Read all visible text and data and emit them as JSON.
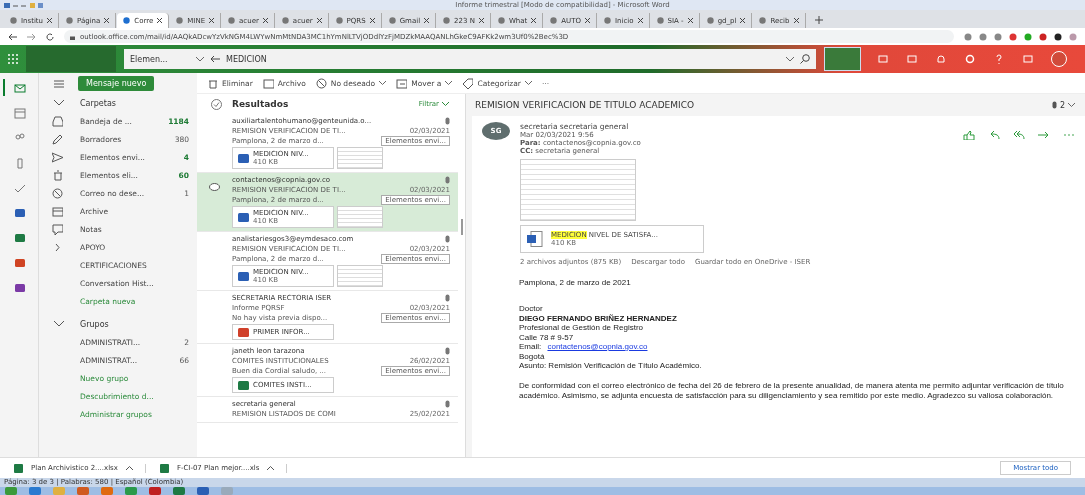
{
  "word_title": "Informe trimestral [Modo de compatibilidad] - Microsoft Word",
  "browser_tabs": [
    {
      "label": "Institu",
      "selected": false
    },
    {
      "label": "Página",
      "selected": false
    },
    {
      "label": "Corre",
      "selected": true
    },
    {
      "label": "MINE",
      "selected": false
    },
    {
      "label": "acuer",
      "selected": false
    },
    {
      "label": "acuer",
      "selected": false
    },
    {
      "label": "PQRS",
      "selected": false
    },
    {
      "label": "Gmail",
      "selected": false
    },
    {
      "label": "223 N",
      "selected": false
    },
    {
      "label": "What",
      "selected": false
    },
    {
      "label": "AUTO",
      "selected": false
    },
    {
      "label": "Inicio",
      "selected": false
    },
    {
      "label": "SIA -",
      "selected": false
    },
    {
      "label": "gd_pl",
      "selected": false
    },
    {
      "label": "Recib",
      "selected": false
    }
  ],
  "address": "outlook.office.com/mail/id/AAQkADcwYzVkNGM4LWYwNmMtNDA3MC1hYmNlLTVjODdlYzFjMDZkMAAQANLhGkeC9AFKk2wm3Uf0%2Bec%3D",
  "outlook_header": {
    "search_scope": "Elemen...",
    "search_query": "MEDICION"
  },
  "new_message": "Mensaje nuevo",
  "toolbar": [
    "Eliminar",
    "Archivo",
    "No deseado",
    "Mover a",
    "Categorizar",
    "···"
  ],
  "rail": [
    {
      "kind": "mail",
      "selected": true
    },
    {
      "kind": "calendar",
      "selected": false
    },
    {
      "kind": "people",
      "selected": false
    },
    {
      "kind": "files",
      "selected": false
    },
    {
      "kind": "todo",
      "selected": false
    },
    {
      "kind": "word",
      "selected": false
    },
    {
      "kind": "excel",
      "selected": false
    },
    {
      "kind": "powerpoint",
      "selected": false
    },
    {
      "kind": "onenote",
      "selected": false
    }
  ],
  "folders_heading": "Carpetas",
  "folders": [
    {
      "kind": "inbox",
      "label": "Bandeja de ...",
      "count": "1184",
      "bold": true
    },
    {
      "kind": "pencil",
      "label": "Borradores",
      "count": "380",
      "bold": false
    },
    {
      "kind": "send",
      "label": "Elementos envi...",
      "count": "4",
      "bold": true
    },
    {
      "kind": "trash",
      "label": "Elementos eli...",
      "count": "60",
      "bold": true
    },
    {
      "kind": "block",
      "label": "Correo no dese...",
      "count": "1",
      "bold": false
    },
    {
      "kind": "archive",
      "label": "Archive"
    },
    {
      "kind": "note",
      "label": "Notas"
    },
    {
      "kind": "chevron",
      "label": "APOYO"
    },
    {
      "kind": "plain",
      "label": "CERTIFICACIONES"
    },
    {
      "kind": "plain",
      "label": "Conversation Hist..."
    },
    {
      "kind": "plain",
      "label": "Carpeta nueva",
      "link": true
    }
  ],
  "groups_heading": "Grupos",
  "groups": [
    {
      "label": "ADMINISTRATI...",
      "count": "2"
    },
    {
      "label": "ADMINISTRAT...",
      "count": "66"
    },
    {
      "label": "Nuevo grupo",
      "link": true
    },
    {
      "label": "Descubrimiento d...",
      "link": true
    },
    {
      "label": "Administrar grupos",
      "link": true
    }
  ],
  "results_title": "Resultados",
  "filter": "Filtrar",
  "messages": [
    {
      "sender": "auxiliartalentohumano@genteunida.o...",
      "subject": "REMISION VERIFICACION DE TI...",
      "date": "02/03/2021",
      "preview": "Pamplona, 2 de marzo d...",
      "folder": "Elementos envi...",
      "attachment": {
        "kind": "word",
        "name": "MEDICION NIV...",
        "size": "410 KB"
      },
      "thumbnail": true,
      "selected": false
    },
    {
      "sender": "contactenos@copnia.gov.co",
      "subject": "REMISION VERIFICACION DE TI...",
      "date": "02/03/2021",
      "preview": "Pamplona, 2 de marzo d...",
      "folder": "Elementos envi...",
      "attachment": {
        "kind": "word",
        "name": "MEDICION NIV...",
        "size": "410 KB"
      },
      "thumbnail": true,
      "selected": true
    },
    {
      "sender": "analistariesgos3@eymdesaco.com",
      "subject": "REMISION VERIFICACION DE TI...",
      "date": "02/03/2021",
      "preview": "Pamplona, 2 de marzo d...",
      "folder": "Elementos envi...",
      "attachment": {
        "kind": "word",
        "name": "MEDICION NIV...",
        "size": "410 KB"
      },
      "thumbnail": true,
      "selected": false
    },
    {
      "sender": "SECRETARIA RECTORIA ISER",
      "subject": "Informe PQRSF",
      "date": "02/03/2021",
      "preview": "No hay vista previa dispo...",
      "folder": "Elementos envi...",
      "attachment": {
        "kind": "pdf",
        "name": "PRIMER INFOR..."
      },
      "thumbnail": false,
      "selected": false
    },
    {
      "sender": "janeth leon tarazona",
      "subject": "COMITES INSTITUCIONALES",
      "date": "26/02/2021",
      "preview": "Buen dia Cordial saludo, ...",
      "folder": "Elementos envi...",
      "attachment": {
        "kind": "excel",
        "name": "COMITES INSTI..."
      },
      "thumbnail": false,
      "selected": false
    },
    {
      "sender": "secretaria general",
      "subject": "REMISION LISTADOS DE COMI",
      "date": "25/02/2021",
      "selected": false
    }
  ],
  "reading": {
    "title": "REMISION VERIFICACION DE TITULO ACADEMICO",
    "attach_count": "2",
    "avatar": "SG",
    "from": "secretaria secretaria general",
    "sent": "Mar 02/03/2021 9:56",
    "to_label": "Para:",
    "to": "contactenos@copnia.gov.co",
    "cc_label": "CC:",
    "cc": "secretaria general",
    "attachment": {
      "highlight": "MEDICION",
      "name": " NIVEL DE SATISFA...",
      "size": "410 KB"
    },
    "attach_summary": "2 archivos adjuntos (875 KB)",
    "download_all": "Descargar todo",
    "save_all": "Guardar todo en OneDrive - ISER",
    "body": [
      {
        "kind": "para",
        "text": "Pamplona, 2 de marzo de 2021"
      },
      {
        "kind": "gap"
      },
      {
        "kind": "line",
        "text": "Doctor"
      },
      {
        "kind": "line",
        "text": "DIEGO FERNANDO BRIÑEZ HERNANDEZ",
        "bold": true
      },
      {
        "kind": "line",
        "text": "Profesional de Gestión de Registro"
      },
      {
        "kind": "line",
        "text": "Calle 78 # 9-57"
      },
      {
        "kind": "email",
        "text": "Email: ",
        "link": "contactenos@copnia.gov.co"
      },
      {
        "kind": "line",
        "text": "Bogotá"
      },
      {
        "kind": "para",
        "text": "Asunto: Remisión Verificación de Título Académico."
      },
      {
        "kind": "para",
        "text": "De conformidad con el correo electrónico de fecha del 26 de febrero de la presente anualidad, de manera atenta me permito adjuntar verificación de título académico.  Asimismo, se adjunta encuesta de satisfacción para su diligenciamiento y sea remitido por este medio. Agradezco su valiosa colaboración."
      }
    ]
  },
  "downloads": [
    {
      "name": "Plan Archivistico 2....xlsx"
    },
    {
      "name": "F-CI-07 Plan mejor....xls"
    }
  ],
  "show_all": "Mostrar todo",
  "word_status": "Página: 3 de 3 | Palabras: 580 | Español (Colombia)"
}
